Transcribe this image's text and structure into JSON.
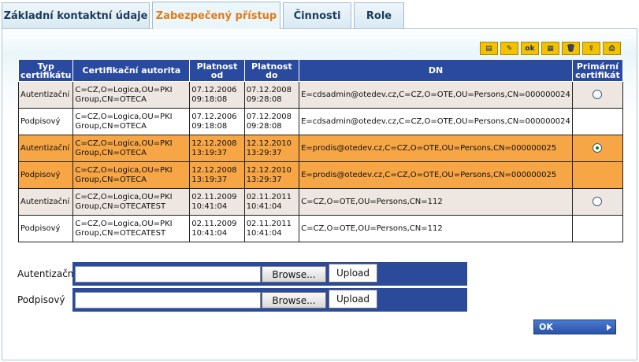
{
  "tabs": [
    {
      "label": "Základní kontaktní údaje"
    },
    {
      "label": "Zabezpečený přístup"
    },
    {
      "label": "Činnosti"
    },
    {
      "label": "Role"
    }
  ],
  "toolbar": {
    "ok_label": "ok",
    "icons": [
      "new-icon",
      "edit-icon",
      "ok-icon",
      "export-icon",
      "delete-icon",
      "import-icon",
      "print-icon"
    ]
  },
  "table": {
    "headers": [
      "Typ certifikátu",
      "Certifikační autorita",
      "Platnost od",
      "Platnost do",
      "DN",
      "Primární certifikát"
    ],
    "rows": [
      {
        "type": "Autentizační",
        "ca": "C=CZ,O=Logica,OU=PKI Group,CN=OTECA",
        "from": "07.12.2006 09:18:08",
        "to": "07.12.2008 09:28:08",
        "dn": "E=cdsadmin@otedev.cz,C=CZ,O=OTE,OU=Persons,CN=000000024",
        "primary": "unchecked"
      },
      {
        "type": "Podpisový",
        "ca": "C=CZ,O=Logica,OU=PKI Group,CN=OTECA",
        "from": "07.12.2006 09:18:08",
        "to": "07.12.2008 09:28:08",
        "dn": "E=cdsadmin@otedev.cz,C=CZ,O=OTE,OU=Persons,CN=000000024",
        "primary": "none"
      },
      {
        "type": "Autentizační",
        "ca": "C=CZ,O=Logica,OU=PKI Group,CN=OTECA",
        "from": "12.12.2008 13:19:37",
        "to": "12.12.2010 13:29:37",
        "dn": "E=prodis@otedev.cz,C=CZ,O=OTE,OU=Persons,CN=000000025",
        "primary": "checked"
      },
      {
        "type": "Podpisový",
        "ca": "C=CZ,O=Logica,OU=PKI Group,CN=OTECA",
        "from": "12.12.2008 13:19:37",
        "to": "12.12.2010 13:29:37",
        "dn": "E=prodis@otedev.cz,C=CZ,O=OTE,OU=Persons,CN=000000025",
        "primary": "none"
      },
      {
        "type": "Autentizační",
        "ca": "C=CZ,O=Logica,OU=PKI Group,CN=OTECATEST",
        "from": "02.11.2009 10:41:04",
        "to": "02.11.2011 10:41:04",
        "dn": "C=CZ,O=OTE,OU=Persons,CN=112",
        "primary": "unchecked"
      },
      {
        "type": "Podpisový",
        "ca": "C=CZ,O=Logica,OU=PKI Group,CN=OTECATEST",
        "from": "02.11.2009 10:41:04",
        "to": "02.11.2011 10:41:04",
        "dn": "C=CZ,O=OTE,OU=Persons,CN=112",
        "primary": "none"
      }
    ]
  },
  "upload": {
    "auth_label": "Autentizační",
    "sign_label": "Podpisový",
    "browse_label": "Browse...",
    "upload_label": "Upload"
  },
  "ok_button": "OK",
  "colors": {
    "header_bg": "#2a4aa0",
    "row_light": "#ede6e1",
    "row_selected": "#f7a646",
    "active_tab_text": "#e07b1a"
  }
}
